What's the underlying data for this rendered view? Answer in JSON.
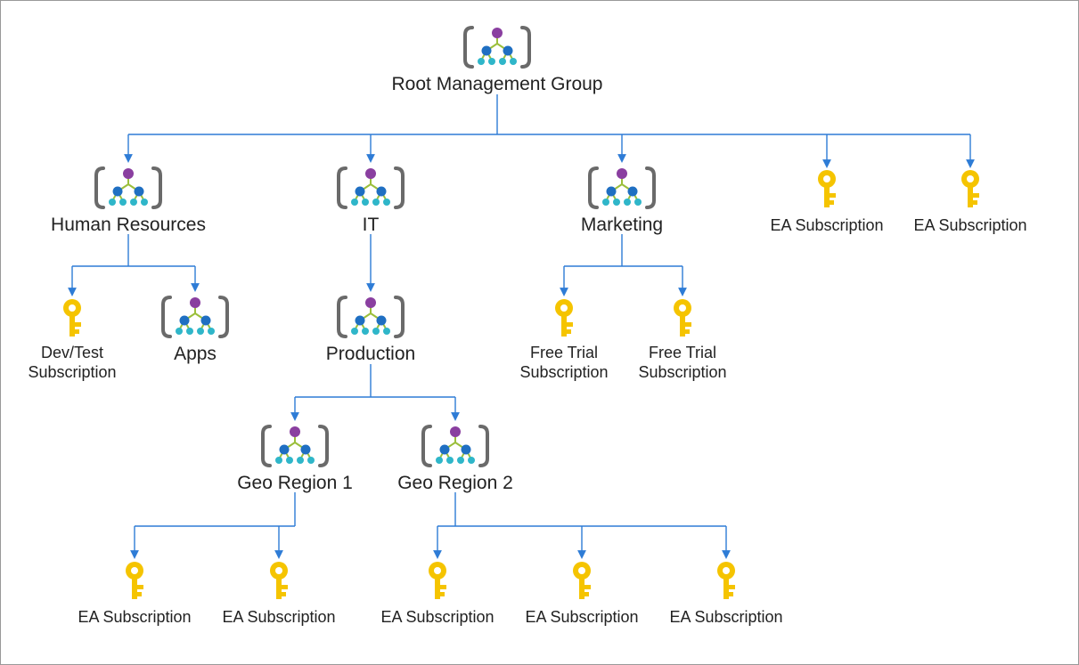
{
  "diagram": {
    "root": {
      "label": "Root Management Group",
      "type": "group"
    },
    "level1": {
      "hr": {
        "label": "Human Resources",
        "type": "group"
      },
      "it": {
        "label": "IT",
        "type": "group"
      },
      "marketing": {
        "label": "Marketing",
        "type": "group"
      },
      "ea1": {
        "label": "EA Subscription",
        "type": "subscription"
      },
      "ea2": {
        "label": "EA Subscription",
        "type": "subscription"
      }
    },
    "hr_children": {
      "devtest": {
        "label1": "Dev/Test",
        "label2": "Subscription",
        "type": "subscription"
      },
      "apps": {
        "label": "Apps",
        "type": "group"
      }
    },
    "it_children": {
      "production": {
        "label": "Production",
        "type": "group"
      }
    },
    "marketing_children": {
      "ft1": {
        "label1": "Free Trial",
        "label2": "Subscription",
        "type": "subscription"
      },
      "ft2": {
        "label1": "Free Trial",
        "label2": "Subscription",
        "type": "subscription"
      }
    },
    "prod_children": {
      "geo1": {
        "label": "Geo Region 1",
        "type": "group"
      },
      "geo2": {
        "label": "Geo Region 2",
        "type": "group"
      }
    },
    "geo1_children": {
      "ea1": {
        "label": "EA Subscription",
        "type": "subscription"
      },
      "ea2": {
        "label": "EA Subscription",
        "type": "subscription"
      }
    },
    "geo2_children": {
      "ea1": {
        "label": "EA Subscription",
        "type": "subscription"
      },
      "ea2": {
        "label": "EA Subscription",
        "type": "subscription"
      },
      "ea3": {
        "label": "EA Subscription",
        "type": "subscription"
      }
    }
  }
}
